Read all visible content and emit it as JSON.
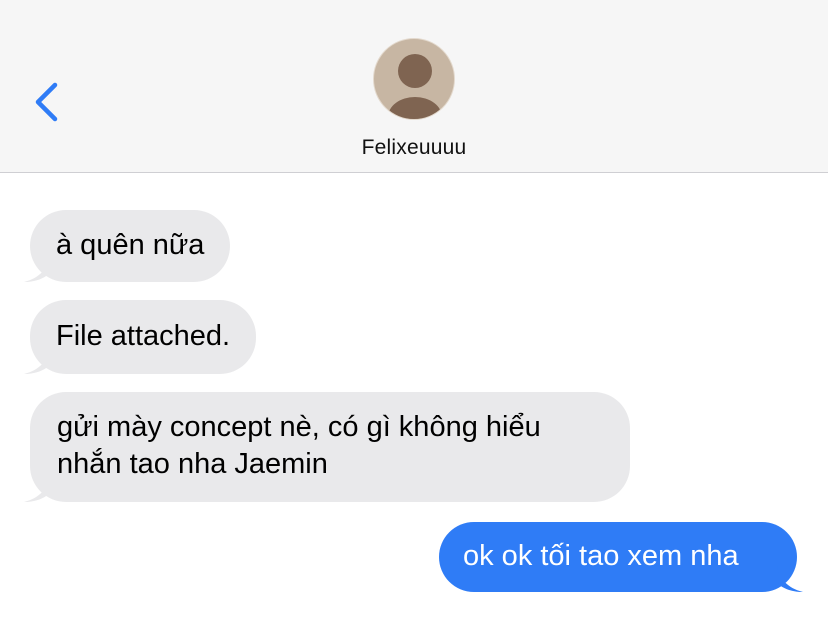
{
  "header": {
    "contact_name": "Felixeuuuu",
    "back_icon": "chevron-left-icon",
    "avatar_icon": "person-silhouette-icon"
  },
  "messages": [
    {
      "direction": "incoming",
      "text": "à quên nữa"
    },
    {
      "direction": "incoming",
      "text": "File attached."
    },
    {
      "direction": "incoming",
      "text": "gửi mày concept nè, có gì không hiểu nhắn tao nha Jaemin"
    },
    {
      "direction": "outgoing",
      "text": "ok ok tối tao xem nha"
    }
  ],
  "colors": {
    "accent": "#2f7cf6",
    "incoming_bubble": "#e9e9eb",
    "header_bg": "#f6f6f6",
    "avatar_bg": "#c7b6a3",
    "avatar_figure": "#7f6451"
  }
}
